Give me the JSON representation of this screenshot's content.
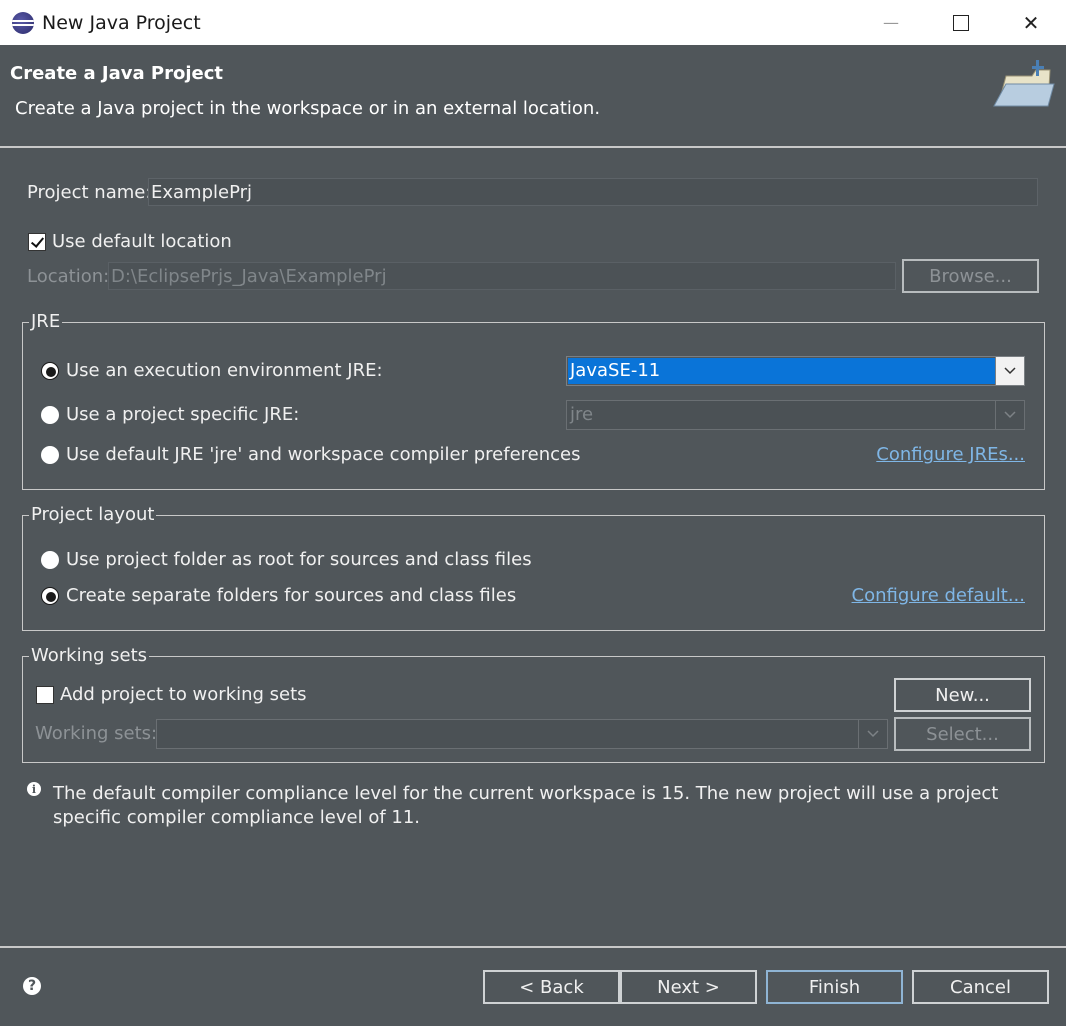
{
  "window": {
    "title": "New Java Project",
    "minimize_glyph": "—",
    "maximize_glyph": "☐",
    "close_glyph": "✕"
  },
  "header": {
    "title": "Create a Java Project",
    "description": "Create a Java project in the workspace or in an external location."
  },
  "project": {
    "name_label": "Project name:",
    "name_value": "ExamplePrj",
    "use_default_location_label": "Use default location",
    "use_default_location_checked": true,
    "location_label": "Location:",
    "location_value": "D:\\EclipsePrjs_Java\\ExamplePrj",
    "browse_label": "Browse..."
  },
  "jre": {
    "group_label": "JRE",
    "option_exec_env": "Use an execution environment JRE:",
    "option_project_specific": "Use a project specific JRE:",
    "option_default": "Use default JRE 'jre' and workspace compiler preferences",
    "exec_env_value": "JavaSE-11",
    "project_specific_value": "jre",
    "configure_link": "Configure JREs..."
  },
  "layout": {
    "group_label": "Project layout",
    "option_root": "Use project folder as root for sources and class files",
    "option_separate": "Create separate folders for sources and class files",
    "configure_link": "Configure default..."
  },
  "working_sets": {
    "group_label": "Working sets",
    "add_label": "Add project to working sets",
    "add_checked": false,
    "new_label": "New...",
    "sets_label": "Working sets:",
    "sets_value": "",
    "select_label": "Select..."
  },
  "info": {
    "message": "The default compiler compliance level for the current workspace is 15. The new project will use a project specific compiler compliance level of 11."
  },
  "footer": {
    "help_glyph": "?",
    "back_label": "< Back",
    "next_label": "Next >",
    "finish_label": "Finish",
    "cancel_label": "Cancel"
  },
  "colors": {
    "dialog_bg": "#50565a",
    "selection_blue": "#0a74d8",
    "link_blue": "#7fb6e6"
  }
}
